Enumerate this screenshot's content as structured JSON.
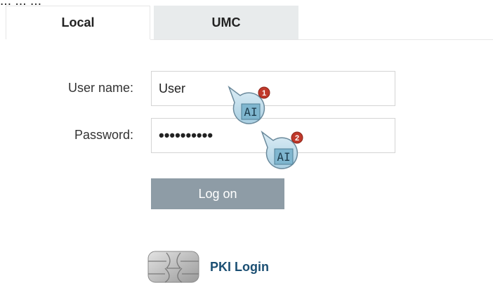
{
  "header": {
    "cut_text": "... ... ..."
  },
  "tabs": [
    {
      "label": "Local",
      "active": true
    },
    {
      "label": "UMC",
      "active": false
    }
  ],
  "form": {
    "username_label": "User name:",
    "username_value": "User",
    "password_label": "Password:",
    "password_value": "••••••••••",
    "login_button": "Log on"
  },
  "pki": {
    "label": "PKI Login"
  },
  "callouts": [
    {
      "number": "1",
      "icon": "text-cursor-icon",
      "text": "AI"
    },
    {
      "number": "2",
      "icon": "text-cursor-icon",
      "text": "AI"
    }
  ],
  "colors": {
    "button_bg": "#8e9ca6",
    "inactive_tab_bg": "#e8ebec",
    "link_color": "#1b4f73",
    "callout_badge": "#c0392b"
  }
}
